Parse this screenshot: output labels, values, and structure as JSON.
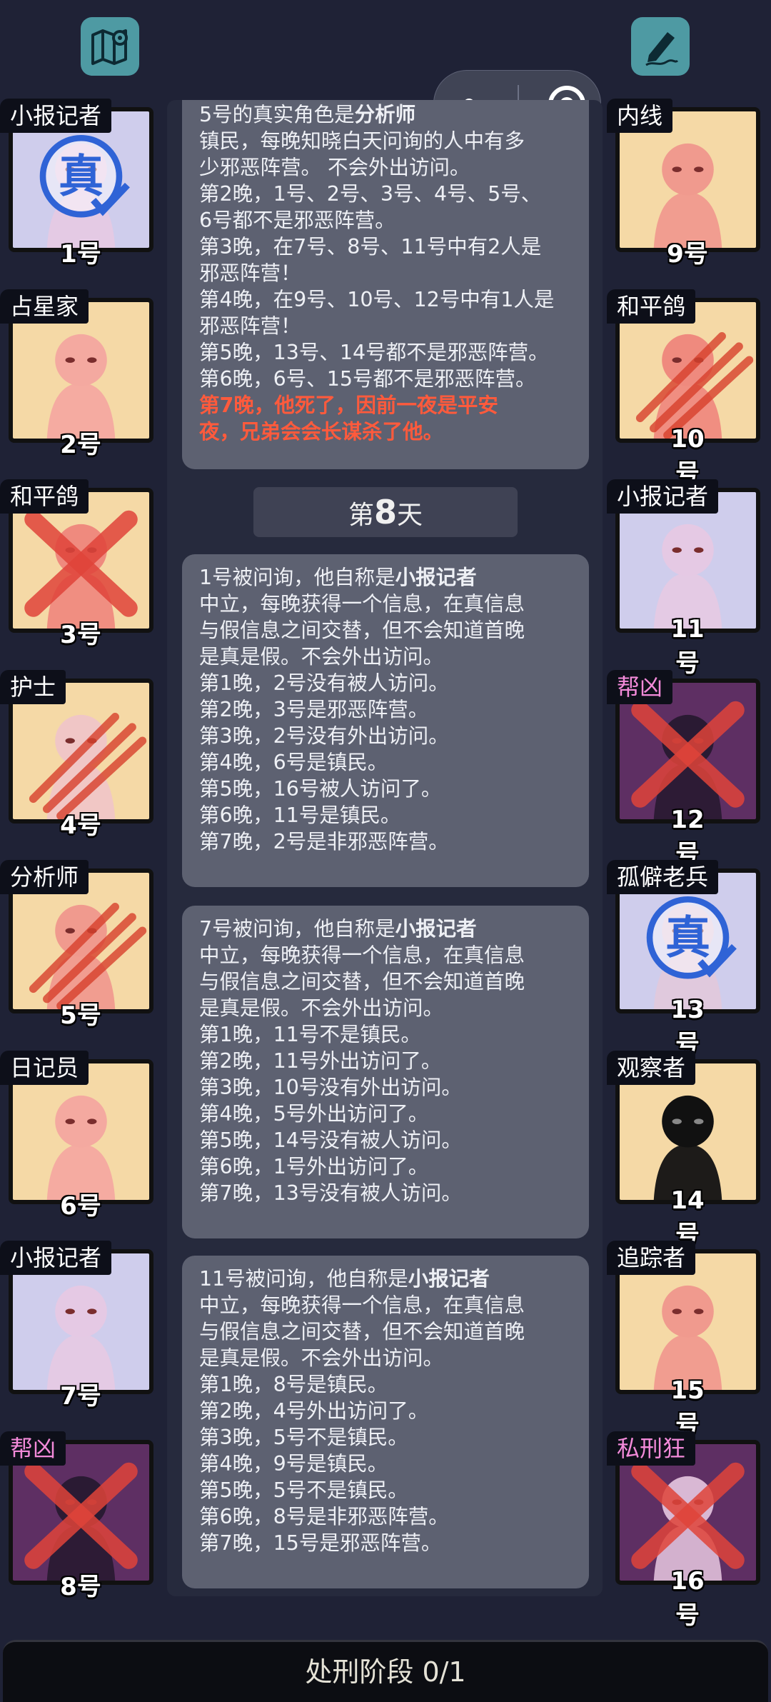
{
  "top_bar": {
    "map_icon": "map-pin-icon",
    "notes_icon": "pen-icon",
    "more_icon": "more-dots-icon",
    "record_icon": "record-icon"
  },
  "players": [
    {
      "num": "1号",
      "role": "小报记者",
      "side": "left",
      "row": 0,
      "bg": "#cfcdec",
      "figure": "#e5c9e4",
      "scratch": false,
      "cross": false,
      "stamp": "真",
      "evil": false
    },
    {
      "num": "2号",
      "role": "占星家",
      "side": "left",
      "row": 1,
      "bg": "#f5d9a6",
      "figure": "#f4a9a0",
      "scratch": false,
      "cross": false,
      "stamp": null,
      "evil": false
    },
    {
      "num": "3号",
      "role": "和平鸽",
      "side": "left",
      "row": 2,
      "bg": "#f5d9a6",
      "figure": "#ef8a7e",
      "scratch": false,
      "cross": true,
      "stamp": null,
      "evil": false
    },
    {
      "num": "4号",
      "role": "护士",
      "side": "left",
      "row": 3,
      "bg": "#f5d9a6",
      "figure": "#f0c6c6",
      "scratch": true,
      "cross": false,
      "stamp": null,
      "evil": false
    },
    {
      "num": "5号",
      "role": "分析师",
      "side": "left",
      "row": 4,
      "bg": "#f5d9a6",
      "figure": "#f09a8e",
      "scratch": true,
      "cross": false,
      "stamp": null,
      "evil": false
    },
    {
      "num": "6号",
      "role": "日记员",
      "side": "left",
      "row": 5,
      "bg": "#f5d9a6",
      "figure": "#f4a9a0",
      "scratch": false,
      "cross": false,
      "stamp": null,
      "evil": false
    },
    {
      "num": "7号",
      "role": "小报记者",
      "side": "left",
      "row": 6,
      "bg": "#cfcdec",
      "figure": "#e5c9e4",
      "scratch": false,
      "cross": false,
      "stamp": null,
      "evil": false
    },
    {
      "num": "8号",
      "role": "帮凶",
      "side": "left",
      "row": 7,
      "bg": "#5e2f63",
      "figure": "#2a1a33",
      "scratch": false,
      "cross": true,
      "stamp": null,
      "evil": true
    },
    {
      "num": "9号",
      "role": "内线",
      "side": "right",
      "row": 0,
      "bg": "#f5d9a6",
      "figure": "#f09a8e",
      "scratch": false,
      "cross": false,
      "stamp": null,
      "evil": false
    },
    {
      "num": "10号",
      "role": "和平鸽",
      "side": "right",
      "row": 1,
      "bg": "#f5d9a6",
      "figure": "#ef8a7e",
      "scratch": true,
      "cross": false,
      "stamp": null,
      "evil": false
    },
    {
      "num": "11号",
      "role": "小报记者",
      "side": "right",
      "row": 2,
      "bg": "#cfcdec",
      "figure": "#e5c9e4",
      "scratch": false,
      "cross": false,
      "stamp": null,
      "evil": false
    },
    {
      "num": "12号",
      "role": "帮凶",
      "side": "right",
      "row": 3,
      "bg": "#5e2f63",
      "figure": "#2a1a33",
      "scratch": false,
      "cross": true,
      "stamp": null,
      "evil": true
    },
    {
      "num": "13号",
      "role": "孤僻老兵",
      "side": "right",
      "row": 4,
      "bg": "#cfcdec",
      "figure": "#e0c8dc",
      "scratch": false,
      "cross": false,
      "stamp": "真",
      "evil": false
    },
    {
      "num": "14号",
      "role": "观察者",
      "side": "right",
      "row": 5,
      "bg": "#f5d9a6",
      "figure": "#111111",
      "scratch": false,
      "cross": false,
      "stamp": null,
      "evil": false
    },
    {
      "num": "15号",
      "role": "追踪者",
      "side": "right",
      "row": 6,
      "bg": "#f5d9a6",
      "figure": "#f09a8e",
      "scratch": false,
      "cross": false,
      "stamp": null,
      "evil": false
    },
    {
      "num": "16号",
      "role": "私刑狂",
      "side": "right",
      "row": 7,
      "bg": "#5e2f63",
      "figure": "#d9b8d4",
      "scratch": false,
      "cross": true,
      "stamp": null,
      "evil": true
    }
  ],
  "log": {
    "msg0": {
      "line0_pre": "5号的真实角色是",
      "line0_bold": "分析师",
      "lines": [
        "镇民，每晚知晓白天问询的人中有多",
        "少邪恶阵营。 不会外出访问。",
        "第2晚，1号、2号、3号、4号、5号、",
        "6号都不是邪恶阵营。",
        "第3晚，在7号、8号、11号中有2人是",
        "邪恶阵营！",
        "第4晚，在9号、10号、12号中有1人是",
        "邪恶阵营！",
        "第5晚，13号、14号都不是邪恶阵营。",
        "第6晚，6号、15号都不是邪恶阵营。"
      ],
      "red_lines": [
        "第7晚，他死了，因前一夜是平安",
        "夜，兄弟会会长谋杀了他。"
      ]
    },
    "day_prefix": "第",
    "day_number": "8",
    "day_suffix": "天",
    "msg1": {
      "pre": "1号被问询，他自称是",
      "bold": "小报记者",
      "lines": [
        "中立，每晚获得一个信息，在真信息",
        "与假信息之间交替，但不会知道首晚",
        "是真是假。不会外出访问。",
        "第1晚，2号没有被人访问。",
        "第2晚，3号是邪恶阵营。",
        "第3晚，2号没有外出访问。",
        "第4晚，6号是镇民。",
        "第5晚，16号被人访问了。",
        "第6晚，11号是镇民。",
        "第7晚，2号是非邪恶阵营。"
      ]
    },
    "msg2": {
      "pre": "7号被问询，他自称是",
      "bold": "小报记者",
      "lines": [
        "中立，每晚获得一个信息，在真信息",
        "与假信息之间交替，但不会知道首晚",
        "是真是假。不会外出访问。",
        "第1晚，11号不是镇民。",
        "第2晚，11号外出访问了。",
        "第3晚，10号没有外出访问。",
        "第4晚，5号外出访问了。",
        "第5晚，14号没有被人访问。",
        "第6晚，1号外出访问了。",
        "第7晚，13号没有被人访问。"
      ]
    },
    "msg3": {
      "pre": "11号被问询，他自称是",
      "bold": "小报记者",
      "lines": [
        "中立，每晚获得一个信息，在真信息",
        "与假信息之间交替，但不会知道首晚",
        "是真是假。不会外出访问。",
        "第1晚，8号是镇民。",
        "第2晚，4号外出访问了。",
        "第3晚，5号不是镇民。",
        "第4晚，9号是镇民。",
        "第5晚，5号不是镇民。",
        "第6晚，8号是非邪恶阵营。",
        "第7晚，15号是邪恶阵营。"
      ]
    }
  },
  "bottom": {
    "phase_label": "处刑阶段 0/1"
  }
}
